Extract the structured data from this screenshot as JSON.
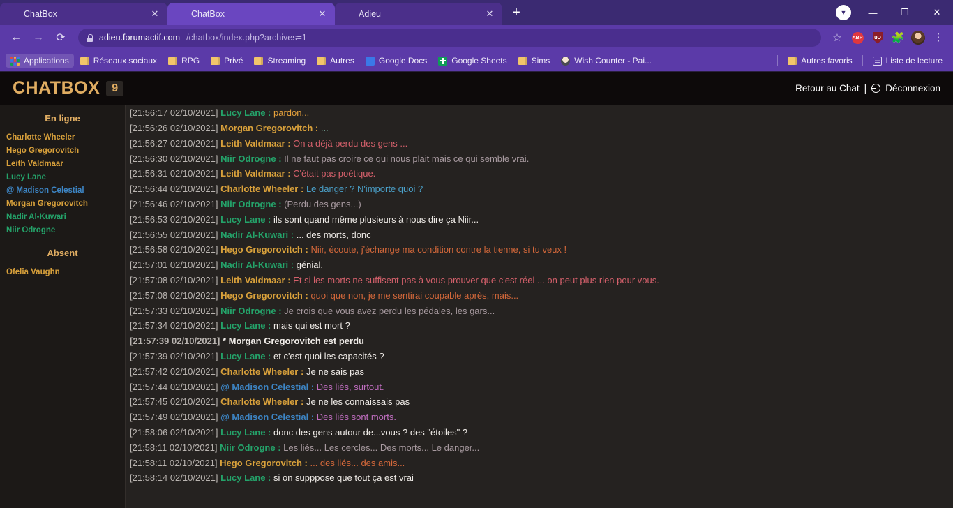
{
  "browser": {
    "tabs": [
      {
        "title": "ChatBox",
        "icon": "star-favicon",
        "active": false
      },
      {
        "title": "ChatBox",
        "icon": "star-favicon",
        "active": true
      },
      {
        "title": "Adieu",
        "icon": "star-favicon",
        "active": false
      }
    ],
    "new_tab_label": "+",
    "window_controls": {
      "minimize": "—",
      "maximize": "❐",
      "close": "✕"
    },
    "nav": {
      "back": "←",
      "forward": "→",
      "reload": "⟳"
    },
    "omnibox": {
      "url_host": "adieu.forumactif.com",
      "url_path": "/chatbox/index.php?archives=1",
      "lock_icon": "lock-icon"
    },
    "toolbar_icons": [
      "star-outline-icon",
      "adblock-plus-icon",
      "ublock-origin-icon",
      "extensions-puzzle-icon",
      "profile-avatar",
      "chrome-menu-kebab-icon"
    ],
    "bookmarks": [
      {
        "label": "Applications",
        "icon": "apps-grid-icon"
      },
      {
        "label": "Réseaux sociaux",
        "icon": "folder-icon"
      },
      {
        "label": "RPG",
        "icon": "folder-icon"
      },
      {
        "label": "Privé",
        "icon": "folder-icon"
      },
      {
        "label": "Streaming",
        "icon": "folder-icon"
      },
      {
        "label": "Autres",
        "icon": "folder-icon"
      },
      {
        "label": "Google Docs",
        "icon": "google-docs-icon"
      },
      {
        "label": "Google Sheets",
        "icon": "google-sheets-icon"
      },
      {
        "label": "Sims",
        "icon": "folder-icon"
      },
      {
        "label": "Wish Counter - Pai...",
        "icon": "wish-counter-icon"
      }
    ],
    "bookmarks_right": [
      {
        "label": "Autres favoris",
        "icon": "folder-icon"
      },
      {
        "label": "Liste de lecture",
        "icon": "reading-list-icon"
      }
    ]
  },
  "chatbox": {
    "title": "CHATBOX",
    "count": "9",
    "back_to_chat": "Retour au Chat",
    "separator": "|",
    "logout": "Déconnexion",
    "sidebar": {
      "online_header": "En ligne",
      "online_users": [
        {
          "name": "Charlotte Wheeler",
          "color": "#d9a13b"
        },
        {
          "name": "Hego Gregorovitch",
          "color": "#d9a13b"
        },
        {
          "name": "Leith Valdmaar",
          "color": "#d9a13b"
        },
        {
          "name": "Lucy Lane",
          "color": "#24a36a"
        },
        {
          "name": "@ Madison Celestial",
          "color": "#3d86c6"
        },
        {
          "name": "Morgan Gregorovitch",
          "color": "#d9a13b"
        },
        {
          "name": "Nadir Al-Kuwari",
          "color": "#24a36a"
        },
        {
          "name": "Niir Odrogne",
          "color": "#24a36a"
        }
      ],
      "absent_header": "Absent",
      "absent_users": [
        {
          "name": "Ofelia Vaughn",
          "color": "#d9a13b"
        }
      ]
    },
    "messages": [
      {
        "ts": "[21:56:17 02/10/2021]",
        "author": "Lucy Lane",
        "author_color": "#24a36a",
        "sep": " : ",
        "text": "pardon...",
        "text_color": "#e8a33c",
        "clipped": true
      },
      {
        "ts": "[21:56:26 02/10/2021]",
        "author": "Morgan Gregorovitch",
        "author_color": "#d9a13b",
        "sep": " : ",
        "text": "...",
        "text_color": "#6f9b8e"
      },
      {
        "ts": "[21:56:27 02/10/2021]",
        "author": "Leith Valdmaar",
        "author_color": "#d9a13b",
        "sep": " : ",
        "text": "On a déjà perdu des gens ...",
        "text_color": "#d4606b"
      },
      {
        "ts": "[21:56:30 02/10/2021]",
        "author": "Niir Odrogne",
        "author_color": "#24a36a",
        "sep": " : ",
        "text": "Il ne faut pas croire ce qui nous plait mais ce qui semble vrai.",
        "text_color": "#a89aa0"
      },
      {
        "ts": "[21:56:31 02/10/2021]",
        "author": "Leith Valdmaar",
        "author_color": "#d9a13b",
        "sep": " : ",
        "text": "C'était pas poétique.",
        "text_color": "#d4606b"
      },
      {
        "ts": "[21:56:44 02/10/2021]",
        "author": "Charlotte Wheeler",
        "author_color": "#d9a13b",
        "sep": " : ",
        "text": "Le danger ? N'importe quoi ?",
        "text_color": "#4aa0c9"
      },
      {
        "ts": "[21:56:46 02/10/2021]",
        "author": "Niir Odrogne",
        "author_color": "#24a36a",
        "sep": " : ",
        "text": "(Perdu des gens...)",
        "text_color": "#a89aa0"
      },
      {
        "ts": "[21:56:53 02/10/2021]",
        "author": "Lucy Lane",
        "author_color": "#24a36a",
        "sep": " : ",
        "text": "ils sont quand même plusieurs à nous dire ça Niir...",
        "text_color": "#f0ece8"
      },
      {
        "ts": "[21:56:55 02/10/2021]",
        "author": "Nadir Al-Kuwari",
        "author_color": "#24a36a",
        "sep": " : ",
        "text": "... des morts, donc",
        "text_color": "#f0ece8"
      },
      {
        "ts": "[21:56:58 02/10/2021]",
        "author": "Hego Gregorovitch",
        "author_color": "#d9a13b",
        "sep": " : ",
        "text": "Niir, écoute, j'échange ma condition contre la tienne, si tu veux !",
        "text_color": "#d4683a"
      },
      {
        "ts": "[21:57:01 02/10/2021]",
        "author": "Nadir Al-Kuwari",
        "author_color": "#24a36a",
        "sep": " : ",
        "text": "génial.",
        "text_color": "#f0ece8"
      },
      {
        "ts": "[21:57:08 02/10/2021]",
        "author": "Leith Valdmaar",
        "author_color": "#d9a13b",
        "sep": " : ",
        "text": "Et si les morts ne suffisent pas à vous prouver que c'est réel ... on peut plus rien pour vous.",
        "text_color": "#d4606b"
      },
      {
        "ts": "[21:57:08 02/10/2021]",
        "author": "Hego Gregorovitch",
        "author_color": "#d9a13b",
        "sep": " : ",
        "text": "quoi que non, je me sentirai coupable après, mais...",
        "text_color": "#d4683a"
      },
      {
        "ts": "[21:57:33 02/10/2021]",
        "author": "Niir Odrogne",
        "author_color": "#24a36a",
        "sep": " : ",
        "text": "Je crois que vous avez perdu les pédales, les gars...",
        "text_color": "#a89aa0"
      },
      {
        "ts": "[21:57:34 02/10/2021]",
        "author": "Lucy Lane",
        "author_color": "#24a36a",
        "sep": " : ",
        "text": "mais qui est mort ?",
        "text_color": "#f0ece8"
      },
      {
        "ts": "[21:57:39 02/10/2021]",
        "action": true,
        "text": "* Morgan Gregorovitch est perdu",
        "text_color": "#f0ece8"
      },
      {
        "ts": "[21:57:39 02/10/2021]",
        "author": "Lucy Lane",
        "author_color": "#24a36a",
        "sep": " : ",
        "text": "et c'est quoi les capacités ?",
        "text_color": "#f0ece8"
      },
      {
        "ts": "[21:57:42 02/10/2021]",
        "author": "Charlotte Wheeler",
        "author_color": "#d9a13b",
        "sep": " : ",
        "text": "Je ne sais pas",
        "text_color": "#f0ece8"
      },
      {
        "ts": "[21:57:44 02/10/2021]",
        "author": "@ Madison Celestial",
        "author_color": "#3d86c6",
        "sep": " : ",
        "text": "Des liés, surtout.",
        "text_color": "#c06ec0"
      },
      {
        "ts": "[21:57:45 02/10/2021]",
        "author": "Charlotte Wheeler",
        "author_color": "#d9a13b",
        "sep": " : ",
        "text": "Je ne les connaissais pas",
        "text_color": "#f0ece8"
      },
      {
        "ts": "[21:57:49 02/10/2021]",
        "author": "@ Madison Celestial",
        "author_color": "#3d86c6",
        "sep": " : ",
        "text": "Des liés sont morts.",
        "text_color": "#c06ec0"
      },
      {
        "ts": "[21:58:06 02/10/2021]",
        "author": "Lucy Lane",
        "author_color": "#24a36a",
        "sep": " : ",
        "text": "donc des gens autour de...vous ? des \"étoiles\" ?",
        "text_color": "#f0ece8"
      },
      {
        "ts": "[21:58:11 02/10/2021]",
        "author": "Niir Odrogne",
        "author_color": "#24a36a",
        "sep": " : ",
        "text": "Les liés... Les cercles... Des morts... Le danger...",
        "text_color": "#a89aa0"
      },
      {
        "ts": "[21:58:11 02/10/2021]",
        "author": "Hego Gregorovitch",
        "author_color": "#d9a13b",
        "sep": " : ",
        "text": "... des liés... des amis...",
        "text_color": "#d4683a"
      },
      {
        "ts": "[21:58:14 02/10/2021]",
        "author": "Lucy Lane",
        "author_color": "#24a36a",
        "sep": " : ",
        "text": "si on supppose que tout ça est vrai",
        "text_color": "#f0ece8"
      }
    ]
  }
}
